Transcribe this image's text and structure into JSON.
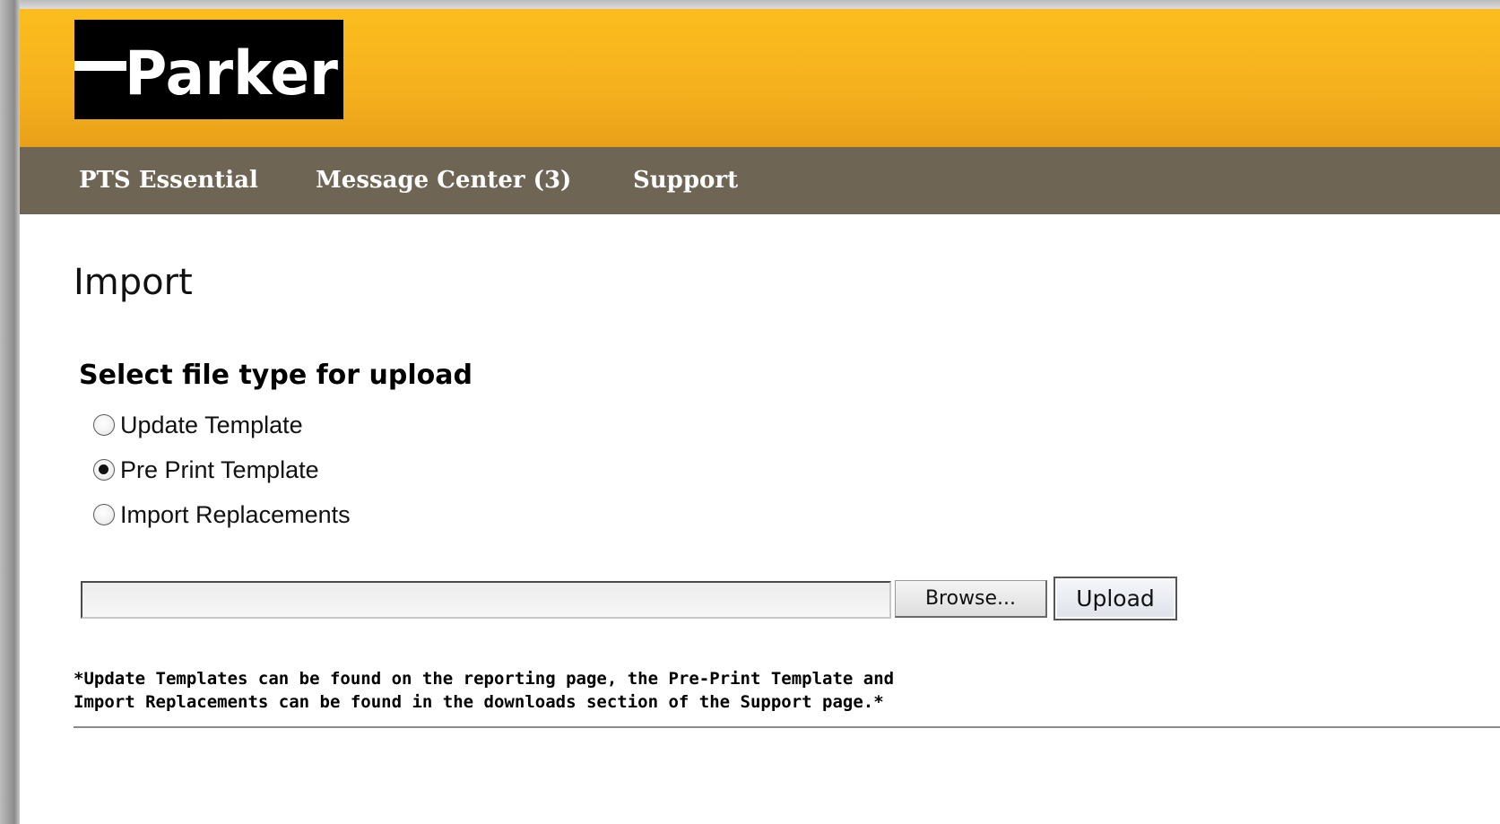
{
  "brand": {
    "logo_text": "Parker",
    "header_color": "#f6b21e",
    "nav_color": "#6e6554"
  },
  "nav": {
    "items": [
      {
        "label": "PTS Essential"
      },
      {
        "label": "Message Center (3)"
      },
      {
        "label": "Support"
      }
    ]
  },
  "page": {
    "title": "Import"
  },
  "upload": {
    "heading": "Select file type for upload",
    "options": [
      {
        "label": "Update Template",
        "checked": false
      },
      {
        "label": "Pre Print Template",
        "checked": true
      },
      {
        "label": "Import Replacements",
        "checked": false
      }
    ],
    "file_value": "",
    "browse_label": "Browse...",
    "upload_label": "Upload"
  },
  "footnote": {
    "line1": "*Update Templates can be found on the reporting page, the Pre-Print Template and",
    "line2": "Import Replacements can be found in the downloads section of the Support page.*"
  }
}
